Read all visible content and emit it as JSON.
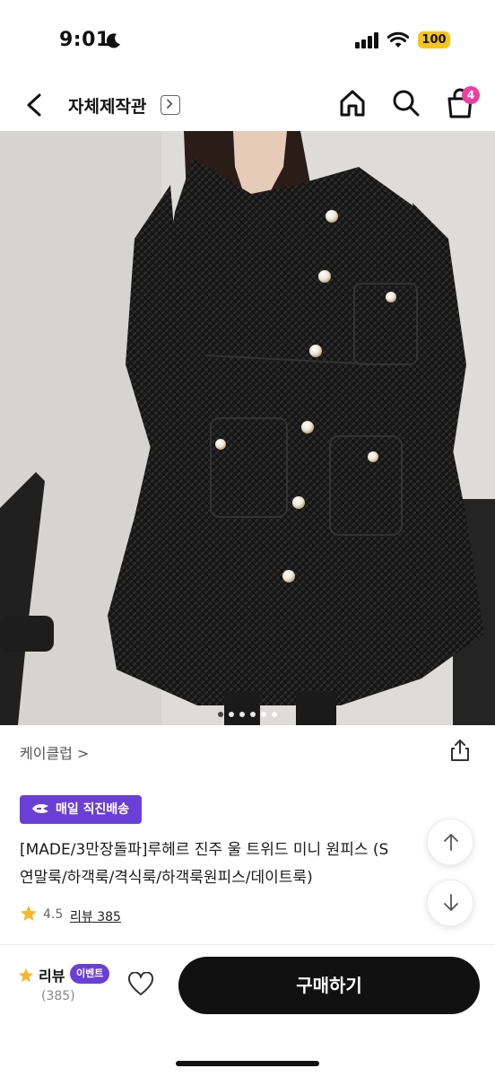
{
  "status_bar": {
    "time": "9:01",
    "battery": "100",
    "icons": [
      "moon-icon",
      "signal-icon",
      "wifi-icon",
      "battery-icon"
    ],
    "battery_color": "#f5c518"
  },
  "header": {
    "title": "자체제작관",
    "cart_count": "4",
    "icons": [
      "back-arrow-icon",
      "chevron-right-icon",
      "home-icon",
      "search-icon",
      "shopping-bag-icon"
    ],
    "badge_color": "#ee3fa0"
  },
  "product": {
    "image_count": 6,
    "active_image_index": 0,
    "store_name": "케이클럽 >",
    "delivery_badge": "매일 직진배송",
    "title_line1": "[MADE/3만장돌파]루헤르 진주 울 트위드 미니 원피스 (S",
    "title_line2": "연말룩/하객룩/격식룩/하객룩원피스/데이트룩)",
    "rating": "4.5",
    "review_link": "리뷰 385",
    "accent_color": "#6a3fd6"
  },
  "bottom_bar": {
    "review_label": "리뷰",
    "event_label": "이벤트",
    "review_count": "(385)",
    "buy_label": "구매하기",
    "icons": [
      "star-icon",
      "heart-icon"
    ]
  },
  "floating": {
    "icons": [
      "arrow-up-icon",
      "arrow-down-icon"
    ]
  }
}
